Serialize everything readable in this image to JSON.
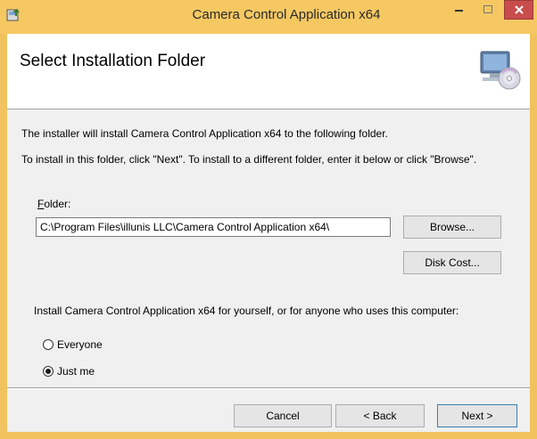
{
  "window": {
    "title": "Camera Control Application x64",
    "icon": "installer-icon",
    "controls": {
      "minimize": "minimize-icon",
      "maximize": "maximize-icon",
      "close": "close-icon"
    }
  },
  "banner": {
    "title": "Select Installation Folder",
    "icon": "computer-disc-icon"
  },
  "body": {
    "line1": "The installer will install Camera Control Application x64 to the following folder.",
    "line2": "To install in this folder, click \"Next\". To install to a different folder, enter it below or click \"Browse\".",
    "folder_label_mnemonic": "F",
    "folder_label_rest": "older:",
    "folder_value": "C:\\Program Files\\illunis LLC\\Camera Control Application x64\\",
    "browse_label": "Browse...",
    "disk_cost_label": "Disk Cost...",
    "install_for_text": "Install Camera Control Application x64 for yourself, or for anyone who uses this computer:",
    "options": [
      {
        "label": "Everyone",
        "selected": false
      },
      {
        "label": "Just me",
        "selected": true
      }
    ]
  },
  "footer": {
    "cancel_label": "Cancel",
    "back_label": "< Back",
    "next_label": "Next >"
  },
  "colors": {
    "titlebar": "#f5c862",
    "close_button": "#c94c4c",
    "next_border": "#3c7fb1"
  }
}
